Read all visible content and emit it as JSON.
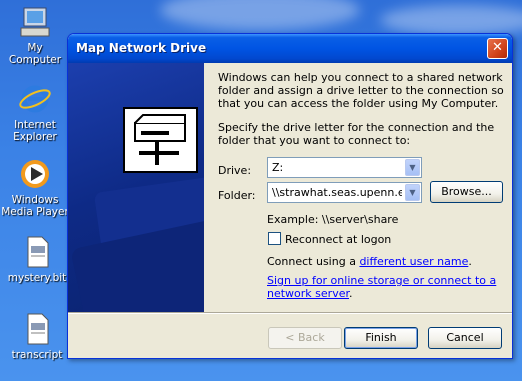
{
  "desktop": {
    "icons": [
      {
        "label": "My Computer"
      },
      {
        "label": "Internet Explorer"
      },
      {
        "label": "Windows Media Player"
      },
      {
        "label": "mystery.bit"
      },
      {
        "label": "transcript"
      }
    ]
  },
  "dialog": {
    "title": "Map Network Drive",
    "close_glyph": "✕",
    "intro": "Windows can help you connect to a shared network folder and assign a drive letter to the connection so that you can access the folder using My Computer.",
    "specify": "Specify the drive letter for the connection and the folder that you want to connect to:",
    "drive_label": "Drive:",
    "drive_value": "Z:",
    "folder_label": "Folder:",
    "folder_value": "\\\\strawhat.seas.upenn.ed",
    "browse_label": "Browse...",
    "example": "Example: \\\\server\\share",
    "reconnect_label": "Reconnect at logon",
    "reconnect_checked": false,
    "connect_prefix": "Connect using a ",
    "connect_link": "different user name",
    "connect_suffix": ".",
    "signup_link_line1": "Sign up for online storage or connect to a",
    "signup_link_line2": "network server",
    "signup_suffix": ".",
    "back_label": "< Back",
    "finish_label": "Finish",
    "cancel_label": "Cancel",
    "dropdown_glyph": "▼"
  },
  "colors": {
    "title_bar": "#0054e3",
    "banner": "#0e2a86",
    "dialog_bg": "#ece9d8",
    "link": "#0000ff"
  }
}
